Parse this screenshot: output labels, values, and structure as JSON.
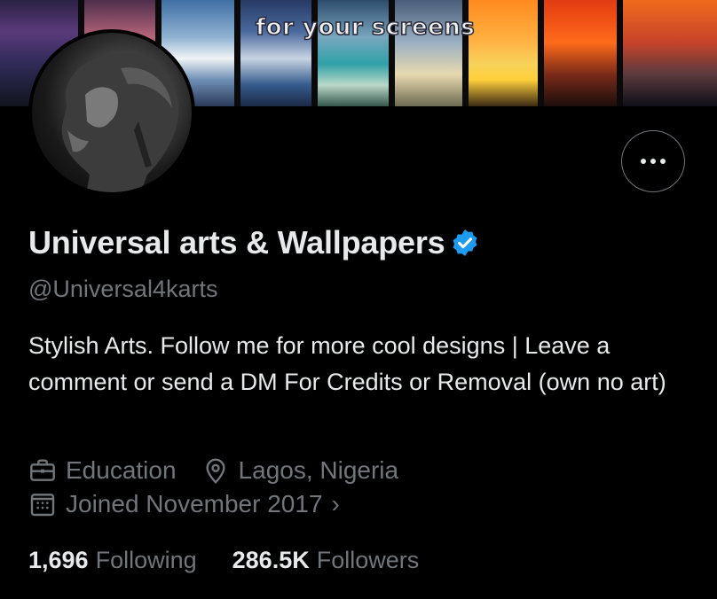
{
  "banner": {
    "caption": "for your screens"
  },
  "profile": {
    "display_name": "Universal arts & Wallpapers",
    "handle": "@Universal4karts",
    "bio": "Stylish Arts. Follow me for more cool designs | Leave a comment or send a DM For Credits or Removal (own no art)",
    "category": "Education",
    "location": "Lagos, Nigeria",
    "joined": "Joined November 2017",
    "joined_chevron": "›",
    "verified_color": "#1d9bf0"
  },
  "stats": {
    "following_count": "1,696",
    "following_label": "Following",
    "followers_count": "286.5K",
    "followers_label": "Followers"
  },
  "icons": {
    "more": "more-horizontal-icon",
    "verified": "verified-badge-icon",
    "category": "briefcase-icon",
    "location": "location-pin-icon",
    "joined": "calendar-icon"
  }
}
